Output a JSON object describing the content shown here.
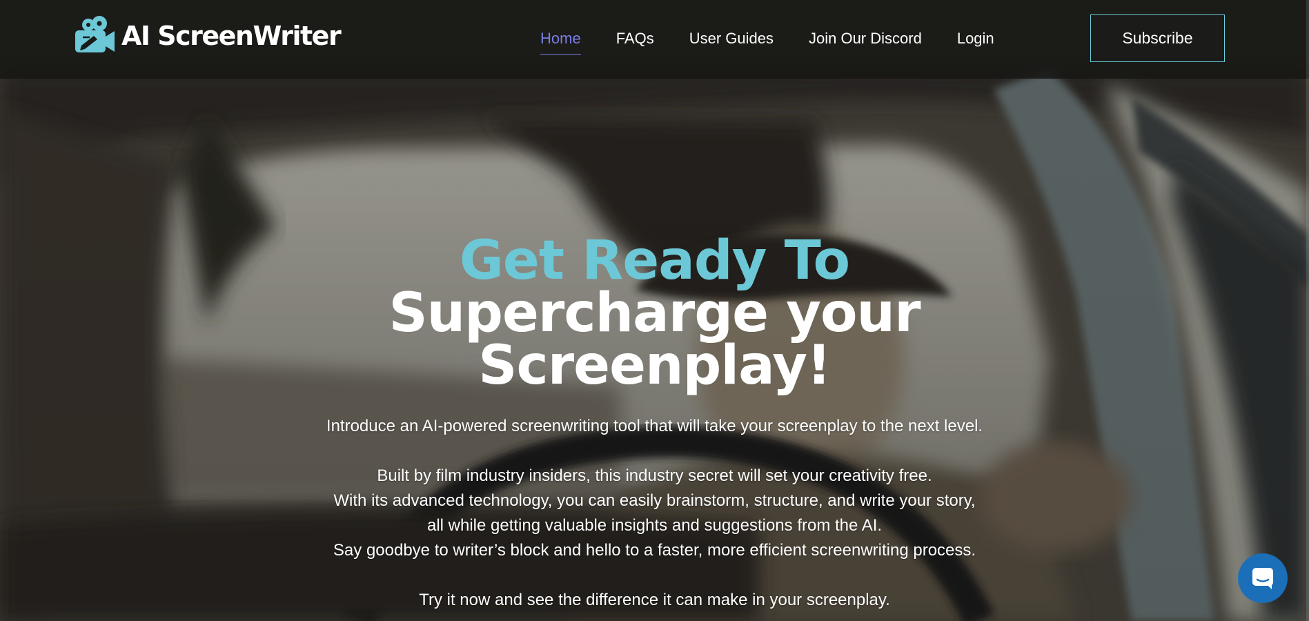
{
  "brand": {
    "name": "AI ScreenWriter",
    "accent_color": "#6cc8d6",
    "logo_icon": "film-camera-icon"
  },
  "nav": {
    "items": [
      {
        "label": "Home",
        "active": true
      },
      {
        "label": "FAQs",
        "active": false
      },
      {
        "label": "User Guides",
        "active": false
      },
      {
        "label": "Join Our Discord",
        "active": false
      },
      {
        "label": "Login",
        "active": false
      }
    ],
    "active_color": "#7b7fe6",
    "subscribe_label": "Subscribe"
  },
  "hero": {
    "headline_accent": "Get Ready To",
    "headline_line2": "Supercharge your",
    "headline_line3": "Screenplay!",
    "intro": "Introduce an AI-powered screenwriting tool that will take your screenplay to the next level.",
    "body": [
      "Built by film industry insiders, this industry secret will set your creativity free.",
      "With its advanced technology, you can easily brainstorm, structure, and write your story,",
      "all while getting valuable insights and suggestions from the AI.",
      "Say goodbye to writer’s block and hello to a faster, more efficient screenwriting process."
    ],
    "cta": "Try it now and see the difference it can make in your screenplay."
  },
  "chat_widget": {
    "icon": "chat-bubble-icon",
    "color": "#1a6fb8"
  }
}
